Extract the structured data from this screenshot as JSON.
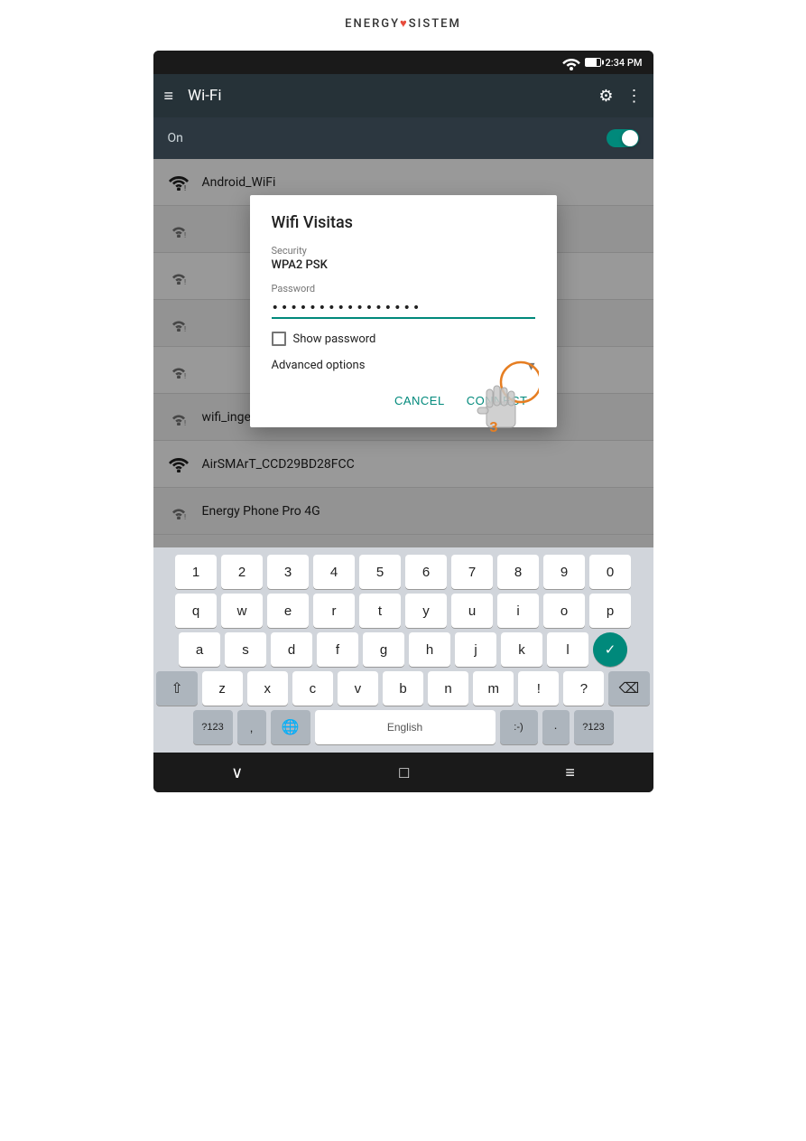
{
  "brand": {
    "name": "ENERGY",
    "heart": "♥",
    "suffix": "SISTEM"
  },
  "status_bar": {
    "time": "2:34 PM"
  },
  "app_bar": {
    "title": "Wi-Fi",
    "settings_icon": "⚙",
    "more_icon": "⋮"
  },
  "toggle": {
    "label": "On"
  },
  "wifi_networks": [
    {
      "name": "Android_WiFi",
      "signal": 3
    },
    {
      "name": "",
      "signal": 2
    },
    {
      "name": "",
      "signal": 2
    },
    {
      "name": "",
      "signal": 2
    },
    {
      "name": "",
      "signal": 2
    },
    {
      "name": "wifi_ingenieria",
      "signal": 2
    },
    {
      "name": "AirSMArT_CCD29BD28FCC",
      "signal": 4
    },
    {
      "name": "Energy Phone Pro 4G",
      "signal": 2
    }
  ],
  "dialog": {
    "title": "Wifi Visitas",
    "security_label": "Security",
    "security_value": "WPA2 PSK",
    "password_label": "Password",
    "password_value": "••••••••••••••••",
    "show_password_label": "Show password",
    "advanced_options_label": "Advanced options",
    "cancel_label": "CANCEL",
    "connect_label": "CONNECT"
  },
  "keyboard": {
    "row_numbers": [
      "1",
      "2",
      "3",
      "4",
      "5",
      "6",
      "7",
      "8",
      "9",
      "0"
    ],
    "row_qwerty": [
      "q",
      "w",
      "e",
      "r",
      "t",
      "y",
      "u",
      "i",
      "o",
      "p"
    ],
    "row_asdf": [
      "a",
      "s",
      "d",
      "f",
      "g",
      "h",
      "j",
      "k",
      "l"
    ],
    "row_zxcv": [
      "z",
      "x",
      "c",
      "v",
      "b",
      "n",
      "m",
      "!",
      "?"
    ],
    "space_label": "English",
    "sym_label": "?123",
    "emoji_label": ":-)",
    "dot_label": "·"
  },
  "nav_bar": {
    "back": "∨",
    "home": "□",
    "recents": "≡"
  },
  "hand_annotation": {
    "number": "3"
  }
}
